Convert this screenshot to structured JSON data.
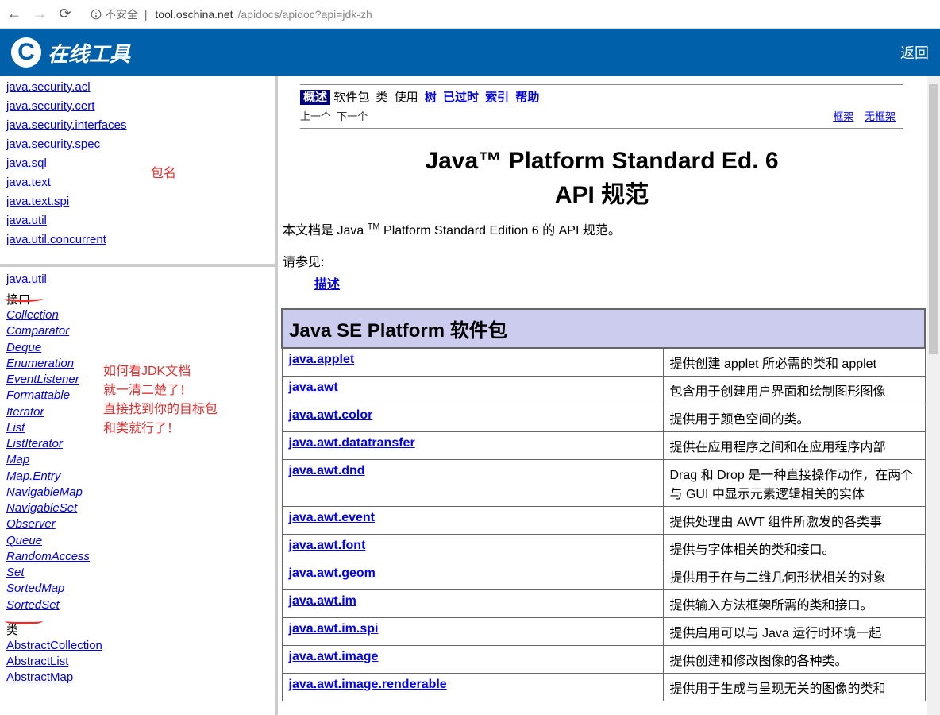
{
  "browser": {
    "insecure": "不安全",
    "url_host": "tool.oschina.net",
    "url_path": "/apidocs/apidoc?api=jdk-zh"
  },
  "header": {
    "logo": "C",
    "title": "在线工具",
    "back": "返回"
  },
  "annotations": {
    "pkg_name": "包名",
    "howto1": "如何看JDK文档",
    "howto2": "就一清二楚了！",
    "howto3": "直接找到你的目标包",
    "howto4": "和类就行了！"
  },
  "left_packages": [
    "java.security.acl",
    "java.security.cert",
    "java.security.interfaces",
    "java.security.spec",
    "java.sql",
    "java.text",
    "java.text.spi",
    "java.util",
    "java.util.concurrent"
  ],
  "cls_frame": {
    "pkg": "java.util",
    "interface_heading": "接口",
    "interfaces": [
      "Collection",
      "Comparator",
      "Deque",
      "Enumeration",
      "EventListener",
      "Formattable",
      "Iterator",
      "List",
      "ListIterator",
      "Map",
      "Map.Entry",
      "NavigableMap",
      "NavigableSet",
      "Observer",
      "Queue",
      "RandomAccess",
      "Set",
      "SortedMap",
      "SortedSet"
    ],
    "class_heading": "类",
    "classes": [
      "AbstractCollection",
      "AbstractList",
      "AbstractMap"
    ]
  },
  "nav": {
    "overview": "概述",
    "package": "软件包",
    "class": "类",
    "use": "使用",
    "tree": "树",
    "deprecated": "已过时",
    "index": "索引",
    "help": "帮助",
    "prev": "上一个",
    "next": "下一个",
    "frames": "框架",
    "noframes": "无框架"
  },
  "main": {
    "title_line1": "Java™ Platform Standard Ed. 6",
    "title_line2": "API 规范",
    "desc_pre": "本文档是 Java ",
    "desc_tm": "TM",
    "desc_post": " Platform Standard Edition 6 的 API 规范。",
    "see_also_label": "请参见:",
    "see_also_link": "描述",
    "table_title": "Java SE Platform 软件包",
    "rows": [
      {
        "pkg": "java.applet",
        "desc": "提供创建 applet 所必需的类和 applet"
      },
      {
        "pkg": "java.awt",
        "desc": "包含用于创建用户界面和绘制图形图像"
      },
      {
        "pkg": "java.awt.color",
        "desc": "提供用于颜色空间的类。"
      },
      {
        "pkg": "java.awt.datatransfer",
        "desc": "提供在应用程序之间和在应用程序内部"
      },
      {
        "pkg": "java.awt.dnd",
        "desc": "Drag 和 Drop 是一种直接操作动作，在两个与 GUI 中显示元素逻辑相关的实体"
      },
      {
        "pkg": "java.awt.event",
        "desc": "提供处理由 AWT 组件所激发的各类事"
      },
      {
        "pkg": "java.awt.font",
        "desc": "提供与字体相关的类和接口。"
      },
      {
        "pkg": "java.awt.geom",
        "desc": "提供用于在与二维几何形状相关的对象"
      },
      {
        "pkg": "java.awt.im",
        "desc": "提供输入方法框架所需的类和接口。"
      },
      {
        "pkg": "java.awt.im.spi",
        "desc": "提供启用可以与 Java 运行时环境一起"
      },
      {
        "pkg": "java.awt.image",
        "desc": "提供创建和修改图像的各种类。"
      },
      {
        "pkg": "java.awt.image.renderable",
        "desc": "提供用于生成与呈现无关的图像的类和"
      }
    ]
  }
}
